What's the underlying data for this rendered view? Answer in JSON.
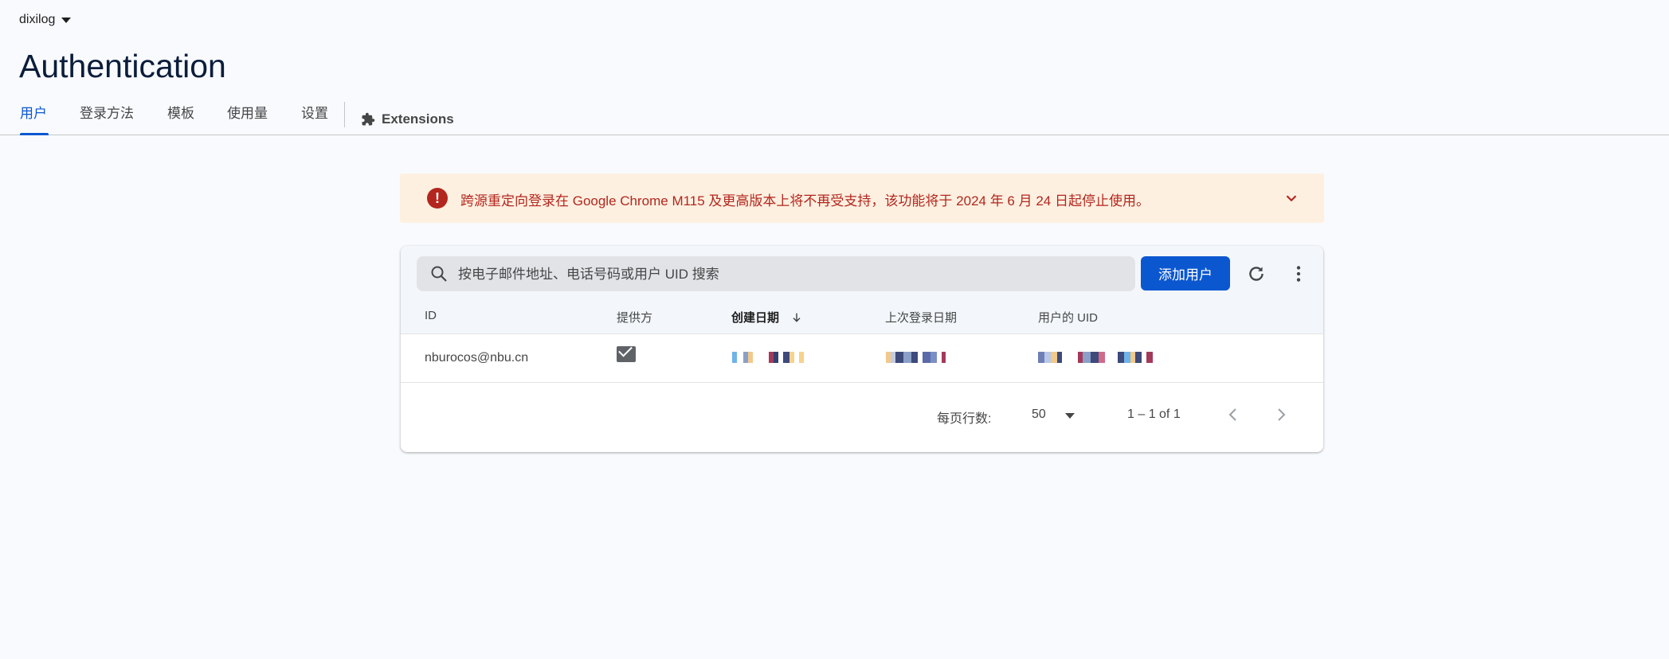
{
  "header": {
    "project_name": "dixilog",
    "title": "Authentication"
  },
  "tabs": [
    {
      "label": "用户",
      "active": true
    },
    {
      "label": "登录方法"
    },
    {
      "label": "模板"
    },
    {
      "label": "使用量"
    },
    {
      "label": "设置"
    },
    {
      "label": "Extensions",
      "icon": "extensions-icon"
    }
  ],
  "banner": {
    "icon": "error-icon",
    "text": "跨源重定向登录在 Google Chrome M115 及更高版本上将不再受支持，该功能将于 2024 年 6 月 24 日起停止使用。",
    "color": "#b3261e"
  },
  "toolbar": {
    "search_placeholder": "按电子邮件地址、电话号码或用户 UID 搜索",
    "add_user_label": "添加用户"
  },
  "table": {
    "columns": [
      "ID",
      "提供方",
      "创建日期",
      "上次登录日期",
      "用户的 UID"
    ],
    "sorted_column": "创建日期",
    "rows": [
      {
        "id": "nburocos@nbu.cn",
        "provider": "email-icon",
        "created": "",
        "last_login": "",
        "uid": ""
      }
    ]
  },
  "pagination": {
    "rows_per_page_label": "每页行数:",
    "rows_per_page": "50",
    "range": "1 – 1 of 1"
  },
  "colors": {
    "accent": "#0b57d0",
    "banner_bg": "#fef0e0",
    "page_bg": "#f8fafd"
  }
}
